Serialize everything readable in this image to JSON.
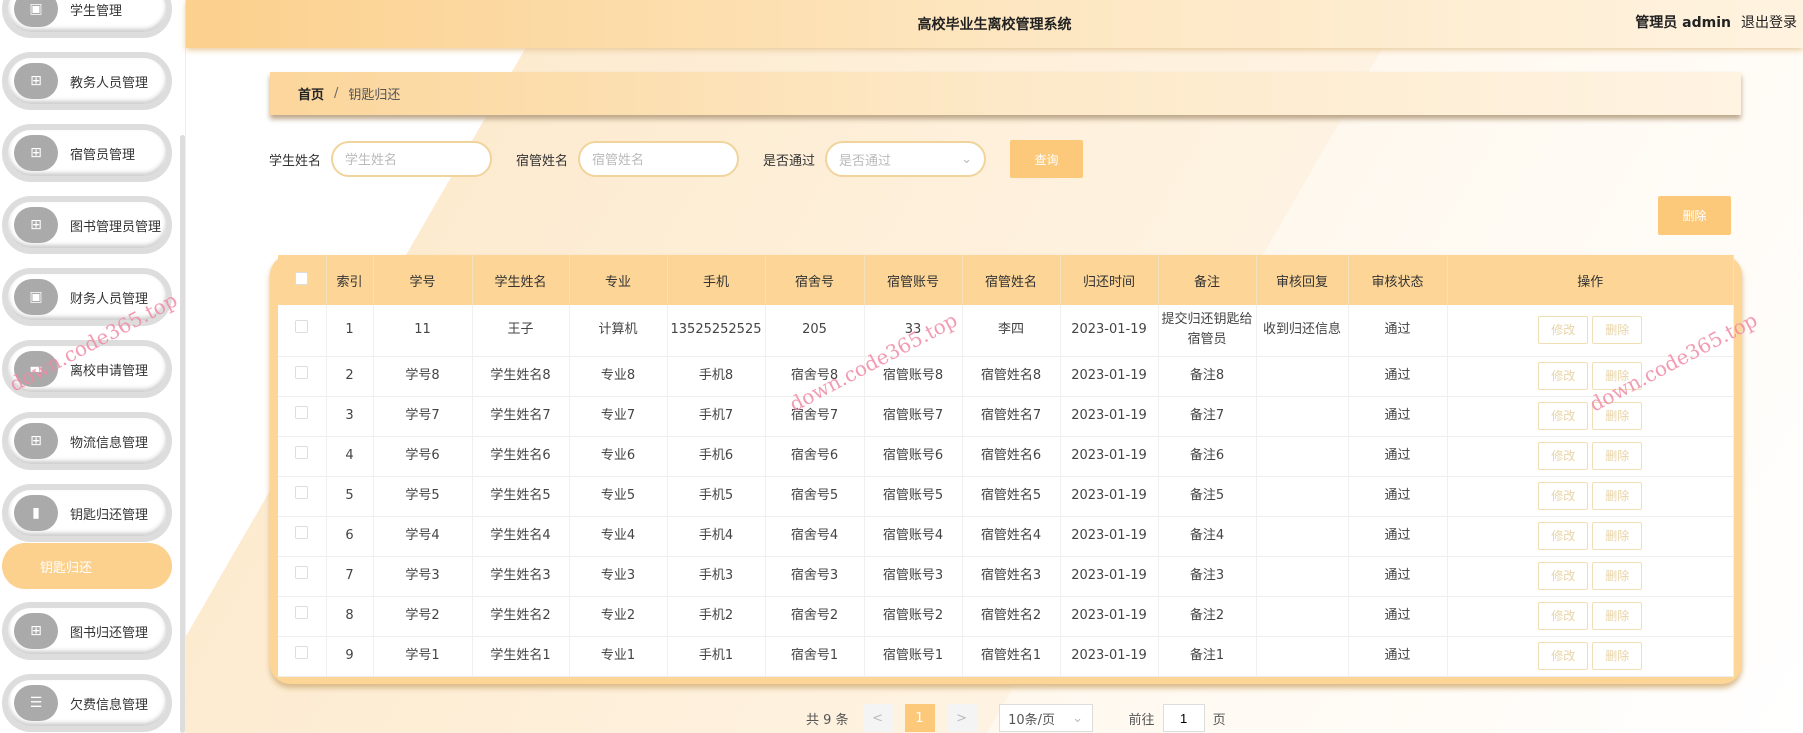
{
  "header": {
    "title": "高校毕业生离校管理系统",
    "user": "管理员 admin",
    "logout": "退出登录"
  },
  "sidebar": {
    "items": [
      {
        "label": "学生管理",
        "icon": "clipboard-icon"
      },
      {
        "label": "教务人员管理",
        "icon": "grid-icon"
      },
      {
        "label": "宿管员管理",
        "icon": "grid-icon"
      },
      {
        "label": "图书管理员管理",
        "icon": "grid-icon"
      },
      {
        "label": "财务人员管理",
        "icon": "clipboard-icon"
      },
      {
        "label": "离校申请管理",
        "icon": "wallet-icon"
      },
      {
        "label": "物流信息管理",
        "icon": "grid-icon"
      },
      {
        "label": "钥匙归还管理",
        "icon": "bar-chart-icon"
      },
      {
        "label": "图书归还管理",
        "icon": "grid-icon"
      },
      {
        "label": "欠费信息管理",
        "icon": "list-icon"
      }
    ],
    "active_sub": "钥匙归还"
  },
  "breadcrumb": {
    "home": "首页",
    "sep": "/",
    "current": "钥匙归还"
  },
  "search": {
    "student_label": "学生姓名",
    "student_placeholder": "学生姓名",
    "manager_label": "宿管姓名",
    "manager_placeholder": "宿管姓名",
    "pass_label": "是否通过",
    "pass_placeholder": "是否通过",
    "query": "查询"
  },
  "delete_label": "删除",
  "table": {
    "headers": [
      "索引",
      "学号",
      "学生姓名",
      "专业",
      "手机",
      "宿舍号",
      "宿管账号",
      "宿管姓名",
      "归还时间",
      "备注",
      "审核回复",
      "审核状态",
      "操作"
    ],
    "rows": [
      [
        "1",
        "11",
        "王子",
        "计算机",
        "13525252525",
        "205",
        "33",
        "李四",
        "2023-01-19",
        "提交归还钥匙给宿管员",
        "收到归还信息",
        "通过"
      ],
      [
        "2",
        "学号8",
        "学生姓名8",
        "专业8",
        "手机8",
        "宿舍号8",
        "宿管账号8",
        "宿管姓名8",
        "2023-01-19",
        "备注8",
        "",
        "通过"
      ],
      [
        "3",
        "学号7",
        "学生姓名7",
        "专业7",
        "手机7",
        "宿舍号7",
        "宿管账号7",
        "宿管姓名7",
        "2023-01-19",
        "备注7",
        "",
        "通过"
      ],
      [
        "4",
        "学号6",
        "学生姓名6",
        "专业6",
        "手机6",
        "宿舍号6",
        "宿管账号6",
        "宿管姓名6",
        "2023-01-19",
        "备注6",
        "",
        "通过"
      ],
      [
        "5",
        "学号5",
        "学生姓名5",
        "专业5",
        "手机5",
        "宿舍号5",
        "宿管账号5",
        "宿管姓名5",
        "2023-01-19",
        "备注5",
        "",
        "通过"
      ],
      [
        "6",
        "学号4",
        "学生姓名4",
        "专业4",
        "手机4",
        "宿舍号4",
        "宿管账号4",
        "宿管姓名4",
        "2023-01-19",
        "备注4",
        "",
        "通过"
      ],
      [
        "7",
        "学号3",
        "学生姓名3",
        "专业3",
        "手机3",
        "宿舍号3",
        "宿管账号3",
        "宿管姓名3",
        "2023-01-19",
        "备注3",
        "",
        "通过"
      ],
      [
        "8",
        "学号2",
        "学生姓名2",
        "专业2",
        "手机2",
        "宿舍号2",
        "宿管账号2",
        "宿管姓名2",
        "2023-01-19",
        "备注2",
        "",
        "通过"
      ],
      [
        "9",
        "学号1",
        "学生姓名1",
        "专业1",
        "手机1",
        "宿舍号1",
        "宿管账号1",
        "宿管姓名1",
        "2023-01-19",
        "备注1",
        "",
        "通过"
      ]
    ],
    "edit": "修改",
    "delete": "删除"
  },
  "pagination": {
    "total": "共 9 条",
    "prev": "<",
    "page": "1",
    "next": ">",
    "size": "10条/页",
    "goto": "前往",
    "goto_value": "1",
    "page_unit": "页"
  },
  "watermark": "down.code365.top"
}
